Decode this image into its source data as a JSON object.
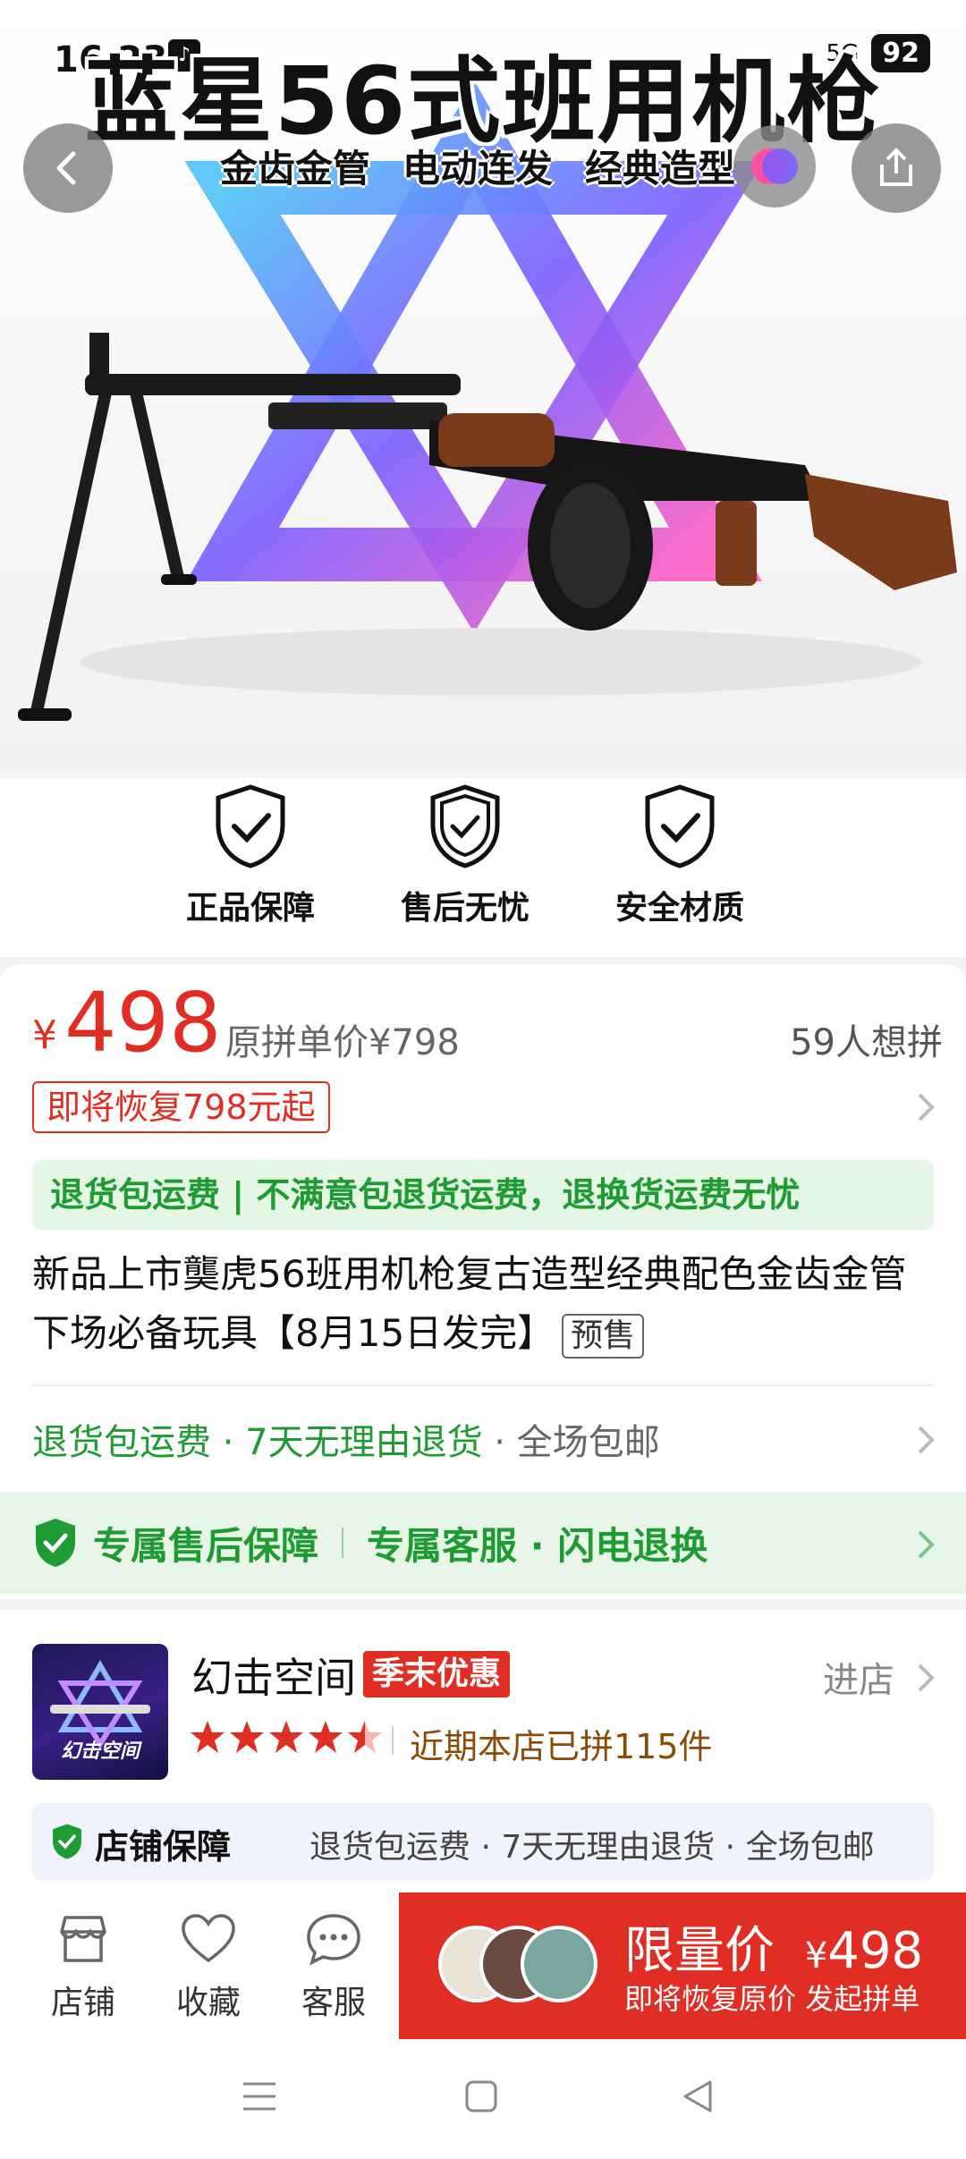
{
  "status_bar": {
    "time": "16:23",
    "signal": "5G",
    "battery": "92"
  },
  "hero": {
    "title": "蓝星56式班用机枪",
    "tags": [
      "金齿金管",
      "电动连发",
      "经典造型"
    ]
  },
  "trust_badges": [
    {
      "label": "正品保障"
    },
    {
      "label": "售后无忧"
    },
    {
      "label": "安全材质"
    }
  ],
  "price": {
    "currency": "¥",
    "current": "498",
    "original": "原拼单价¥798",
    "want_count": "59人想拼",
    "restore_tag": "即将恢复798元起"
  },
  "return_banner": "退货包运费 | 不满意包退货运费，退换货运费无忧",
  "product": {
    "title": "新品上市龑虎56班用机枪复古造型经典配色金齿金管下场必备玩具【8月15日发完】",
    "presale_badge": "预售"
  },
  "services": {
    "green": "退货包运费 · 7天无理由退货",
    "grey": " · 全场包邮"
  },
  "guarantee": {
    "title": "专属售后保障",
    "items": "专属客服 · 闪电退换"
  },
  "store": {
    "name": "幻击空间",
    "badge": "季末优惠",
    "enter": "进店",
    "logo_text": "幻击空间",
    "rating": 4.5,
    "recent_sales": "近期本店已拼115件",
    "guarantee_title": "店铺保障",
    "guarantee_items": "退货包运费 · 7天无理由退货 · 全场包邮"
  },
  "action_bar": {
    "store": "店铺",
    "favorite": "收藏",
    "service": "客服",
    "buy_label": "限量价",
    "buy_currency": "¥",
    "buy_price": "498",
    "buy_sub": "即将恢复原价 发起拼单"
  },
  "colors": {
    "accent_red": "#e02e24",
    "green": "#1f9b33"
  }
}
